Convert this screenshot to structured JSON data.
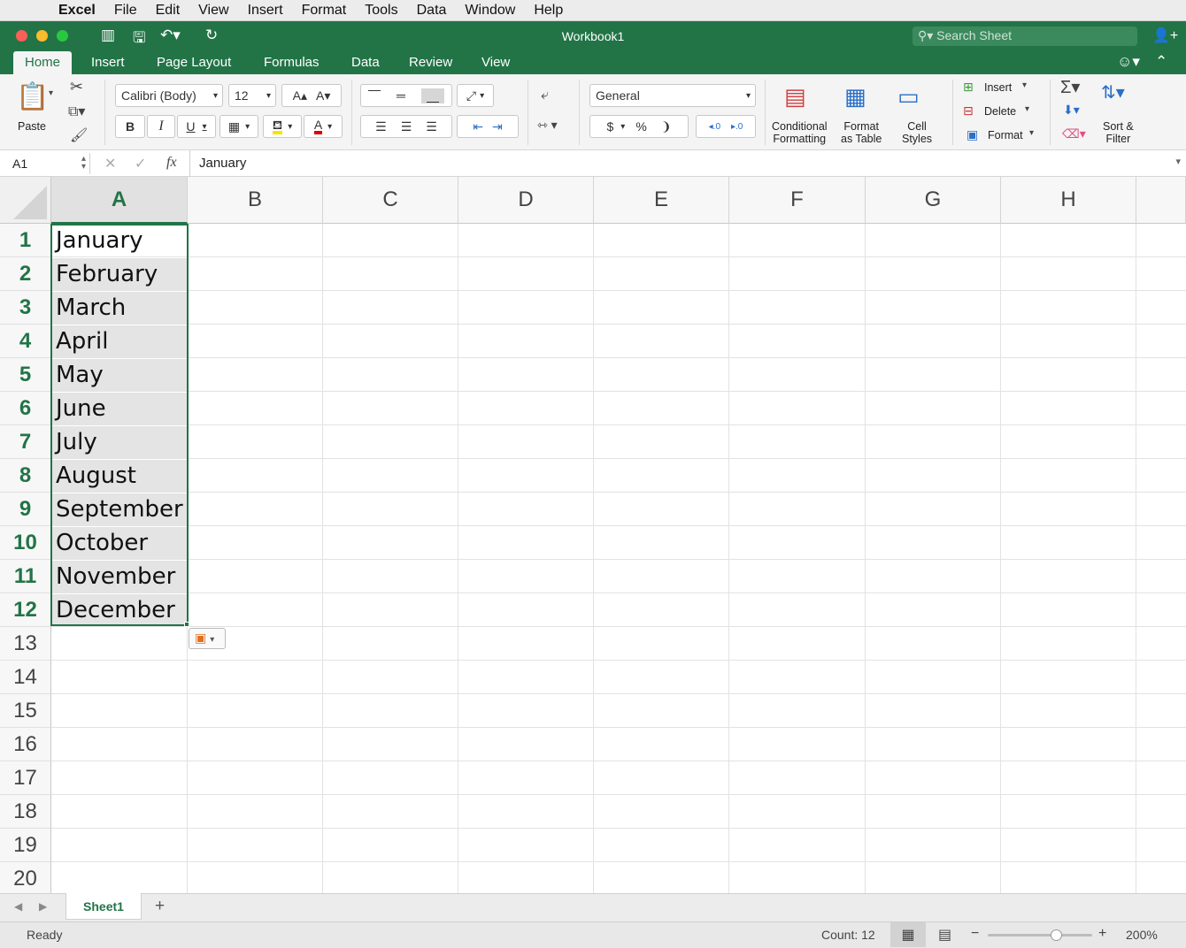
{
  "menubar": {
    "app": "Excel",
    "items": [
      "File",
      "Edit",
      "View",
      "Insert",
      "Format",
      "Tools",
      "Data",
      "Window",
      "Help"
    ]
  },
  "window": {
    "title": "Workbook1",
    "search_placeholder": "Search Sheet"
  },
  "ribbon_tabs": [
    "Home",
    "Insert",
    "Page Layout",
    "Formulas",
    "Data",
    "Review",
    "View"
  ],
  "ribbon": {
    "paste": "Paste",
    "font_name": "Calibri (Body)",
    "font_size": "12",
    "number_format": "General",
    "bold": "B",
    "italic": "I",
    "underline": "U",
    "currency": "$",
    "percent": "%",
    "comma": "❩",
    "increase_decimal": ".0\n.00",
    "conditional_formatting": "Conditional\nFormatting",
    "format_as_table": "Format\nas Table",
    "cell_styles": "Cell\nStyles",
    "insert": "Insert",
    "delete": "Delete",
    "format": "Format",
    "sort_filter": "Sort &\nFilter"
  },
  "formula_bar": {
    "name_box": "A1",
    "content": "January"
  },
  "columns": [
    "A",
    "B",
    "C",
    "D",
    "E",
    "F",
    "G",
    "H"
  ],
  "rows": [
    "1",
    "2",
    "3",
    "4",
    "5",
    "6",
    "7",
    "8",
    "9",
    "10",
    "11",
    "12",
    "13",
    "14",
    "15",
    "16",
    "17",
    "18",
    "19",
    "20"
  ],
  "cells": [
    "January",
    "February",
    "March",
    "April",
    "May",
    "June",
    "July",
    "August",
    "September",
    "October",
    "November",
    "December"
  ],
  "sheets": [
    "Sheet1"
  ],
  "status": {
    "ready": "Ready",
    "count": "Count: 12",
    "zoom": "200%",
    "zoom_level_fraction": 0.65
  },
  "colors": {
    "accent": "#227447",
    "selection_fill": "#e4e4e4"
  }
}
